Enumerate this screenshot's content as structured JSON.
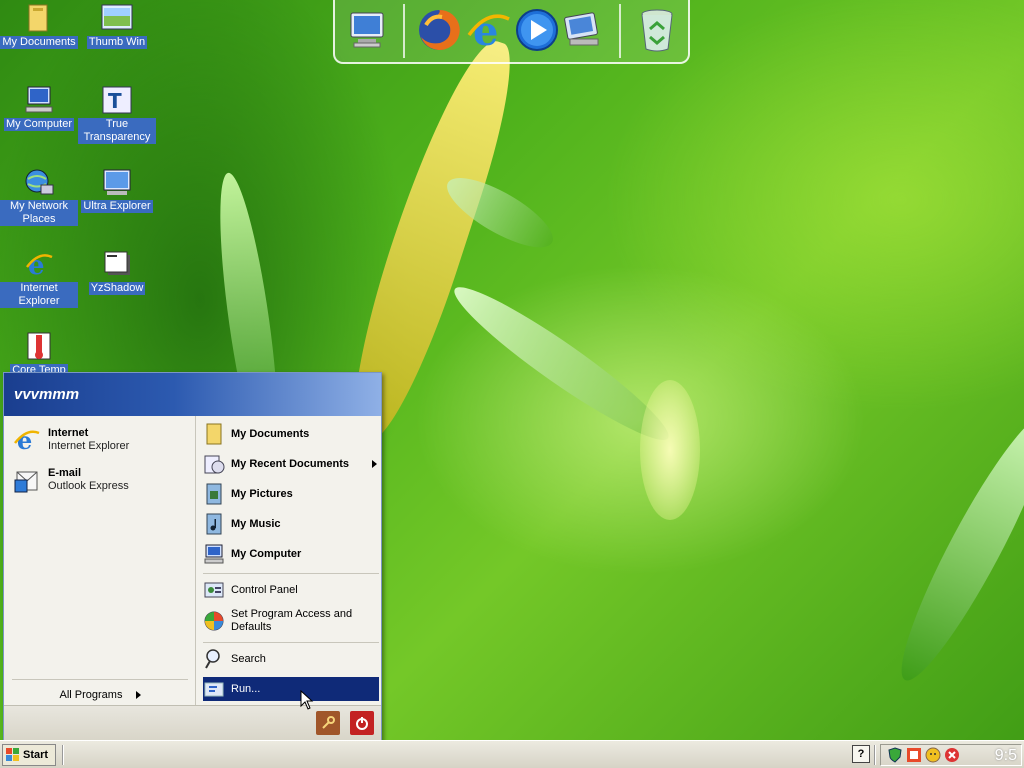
{
  "desktop": {
    "icons": [
      {
        "label": "My Documents"
      },
      {
        "label": "Thumb Win"
      },
      {
        "label": "My Computer"
      },
      {
        "label": "True Transparency"
      },
      {
        "label": "My Network Places"
      },
      {
        "label": "Ultra Explorer"
      },
      {
        "label": "Internet Explorer"
      },
      {
        "label": "YzShadow"
      },
      {
        "label": "Core Temp"
      }
    ]
  },
  "dock": {
    "items": [
      "my-computer-icon",
      "firefox-icon",
      "internet-explorer-icon",
      "media-player-icon",
      "network-icon",
      "recycle-bin-icon"
    ]
  },
  "start_menu": {
    "user_name": "vvvmmm",
    "pinned": [
      {
        "title": "Internet",
        "subtitle": "Internet Explorer"
      },
      {
        "title": "E-mail",
        "subtitle": "Outlook Express"
      }
    ],
    "all_programs": "All Programs",
    "right": {
      "my_documents": "My Documents",
      "my_recent_documents": "My Recent Documents",
      "my_pictures": "My Pictures",
      "my_music": "My Music",
      "my_computer": "My Computer",
      "control_panel": "Control Panel",
      "set_program_access": "Set Program Access and Defaults",
      "search": "Search",
      "run": "Run..."
    }
  },
  "taskbar": {
    "start_label": "Start",
    "help_label": "?",
    "clock": "9:5"
  },
  "colors": {
    "menu_header": "#2c5ab0",
    "selection": "#0f2a78",
    "icon_label_bg": "#3a6bbf"
  }
}
